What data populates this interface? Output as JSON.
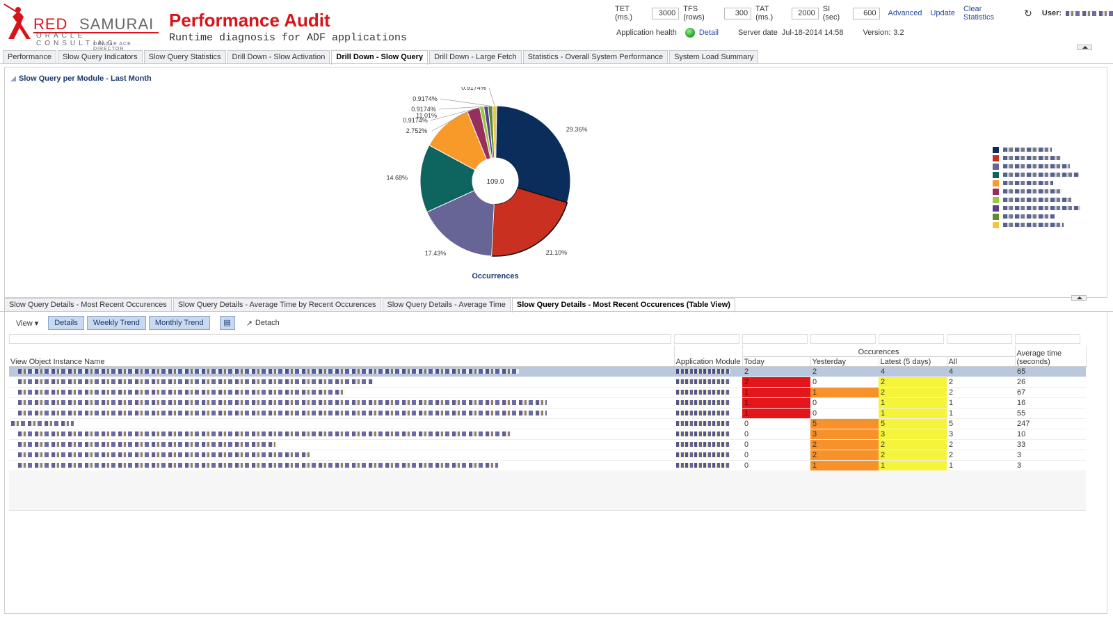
{
  "header": {
    "logo_red": "RED",
    "logo_samurai": "SAMURAI",
    "logo_oc": "ORACLE CONSULTING",
    "logo_ace": "ORACLE ACE DIRECTOR",
    "title": "Performance Audit",
    "subtitle": "Runtime diagnosis for ADF applications",
    "params": [
      {
        "label": "TET (ms.)",
        "value": "3000"
      },
      {
        "label": "TFS (rows)",
        "value": "300"
      },
      {
        "label": "TAT (ms.)",
        "value": "2000"
      },
      {
        "label": "SI (sec)",
        "value": "600"
      }
    ],
    "links": {
      "advanced": "Advanced",
      "update": "Update",
      "clear": "Clear Statistics"
    },
    "user_label": "User:",
    "health_label": "Application health",
    "detail_link": "Detail",
    "server_date_label": "Server date",
    "server_date": "Jul-18-2014 14:58",
    "version_label": "Version:",
    "version": "3.2"
  },
  "tabs": [
    "Performance",
    "Slow Query Indicators",
    "Slow Query Statistics",
    "Drill Down - Slow Activation",
    "Drill Down - Slow Query",
    "Drill Down - Large Fetch",
    "Statistics - Overall System Performance",
    "System Load Summary"
  ],
  "active_tab": 4,
  "panel1": {
    "title": "Slow Query per Module - Last Month"
  },
  "chart_data": {
    "type": "pie",
    "donut": true,
    "center_label": "109.0",
    "footer_label": "Occurrences",
    "values": [
      29.36,
      21.1,
      17.43,
      14.68,
      11.01,
      2.752,
      0.9174,
      0.9174,
      0.9174,
      0.9174
    ],
    "labels": [
      "29.36%",
      "21.10%",
      "17.43%",
      "14.68%",
      "11.01%",
      "2.752%",
      "0.9174%",
      "0.9174%",
      "0.9174%",
      "0.9174%"
    ],
    "colors": [
      "#0a2d5c",
      "#c9301f",
      "#676596",
      "#0e6560",
      "#f79a2a",
      "#962f5e",
      "#9ac83f",
      "#5a3f8f",
      "#5e8f2e",
      "#f1c644"
    ]
  },
  "tabs2": [
    "Slow Query Details - Most Recent Occurences",
    "Slow Query Details - Average Time by Recent Occurences",
    "Slow Query Details - Average Time",
    "Slow Query Details - Most Recent Occurences (Table View)"
  ],
  "active_tab2": 3,
  "toolbar": {
    "view": "View ▾",
    "details": "Details",
    "weekly": "Weekly Trend",
    "monthly": "Monthly Trend",
    "detach": "Detach"
  },
  "table": {
    "col_name": "View Object Instance Name",
    "col_module": "Application Module",
    "group_occ": "Occurences",
    "col_today": "Today",
    "col_yesterday": "Yesterday",
    "col_latest": "Latest (5 days)",
    "col_all": "All",
    "col_avg": "Average time (seconds)",
    "rows": [
      {
        "today": "2",
        "yesterday": "2",
        "latest": "4",
        "all": "4",
        "avg": "65"
      },
      {
        "today": "2",
        "yesterday": "0",
        "latest": "2",
        "all": "2",
        "avg": "26"
      },
      {
        "today": "1",
        "yesterday": "1",
        "latest": "2",
        "all": "2",
        "avg": "67"
      },
      {
        "today": "1",
        "yesterday": "0",
        "latest": "1",
        "all": "1",
        "avg": "16"
      },
      {
        "today": "1",
        "yesterday": "0",
        "latest": "1",
        "all": "1",
        "avg": "55"
      },
      {
        "today": "0",
        "yesterday": "5",
        "latest": "5",
        "all": "5",
        "avg": "247"
      },
      {
        "today": "0",
        "yesterday": "3",
        "latest": "3",
        "all": "3",
        "avg": "10"
      },
      {
        "today": "0",
        "yesterday": "2",
        "latest": "2",
        "all": "2",
        "avg": "33"
      },
      {
        "today": "0",
        "yesterday": "2",
        "latest": "2",
        "all": "2",
        "avg": "3"
      },
      {
        "today": "0",
        "yesterday": "1",
        "latest": "1",
        "all": "1",
        "avg": "3"
      }
    ]
  }
}
